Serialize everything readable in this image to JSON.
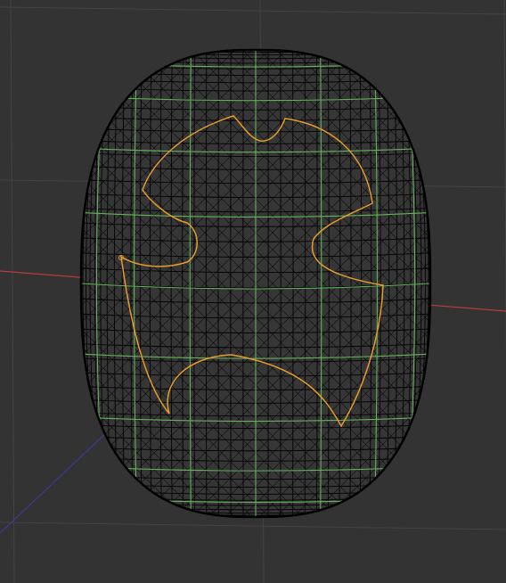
{
  "viewport": {
    "background": "#333333",
    "grid_color": "#3d3d3d",
    "grid_major_color": "#444444"
  },
  "axes": {
    "x_axis_color": "#b93b3b",
    "z_axis_color": "#3d3dc0"
  },
  "mesh": {
    "shape": "capsule",
    "wire_color": "#000000",
    "edge_loop_color": "#63b35a"
  },
  "selection": {
    "curve_color": "#e59c2b",
    "shape": "bat-like emblem"
  }
}
